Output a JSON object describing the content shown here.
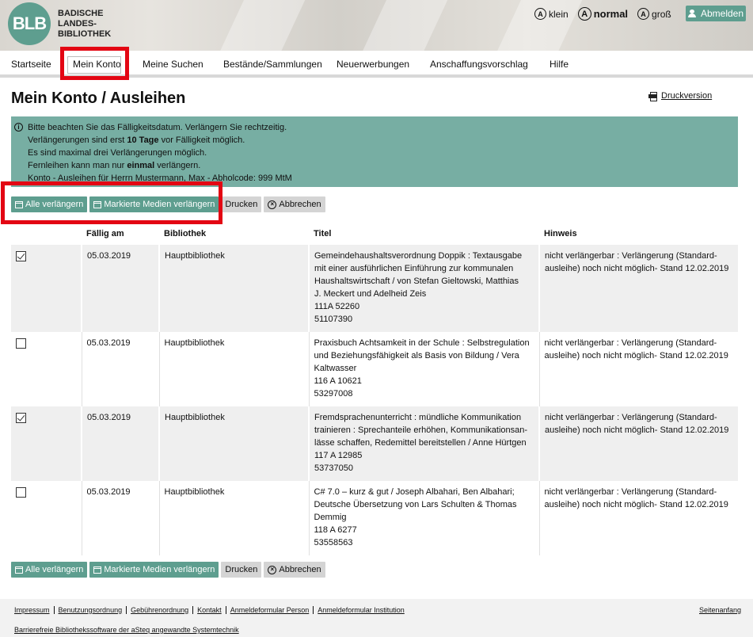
{
  "header": {
    "logo_short": "BLB",
    "logo_lines": [
      "BADISCHE",
      "LANDES-",
      "BIBLIOTHEK"
    ],
    "font_sizes": [
      {
        "symbol": "A",
        "label": "klein"
      },
      {
        "symbol": "A",
        "label": "normal"
      },
      {
        "symbol": "A",
        "label": "groß"
      }
    ],
    "logout_label": "Abmelden",
    "logout_icon": "user-icon"
  },
  "nav": {
    "items": [
      "Startseite",
      "Mein Konto",
      "Meine Suchen",
      "Bestände/Sammlungen",
      "Neuerwerbungen",
      "Anschaffungsvorschlag",
      "Hilfe"
    ],
    "active": "Mein Konto"
  },
  "page": {
    "title": "Mein Konto / Ausleihen",
    "print_label": "Druckversion",
    "print_icon": "printer-icon"
  },
  "notice": {
    "icon": "info-icon",
    "line1": "Bitte beachten Sie das Fälligkeitsdatum. Verlängern Sie rechtzeitig.",
    "line2_pre": "Verlängerungen sind erst ",
    "line2_bold": "10 Tage",
    "line2_post": " vor Fälligkeit möglich.",
    "line3": "Es sind maximal drei Verlängerungen möglich.",
    "line4_pre": "Fernleihen kann man nur ",
    "line4_bold": "einmal",
    "line4_post": " verlängern.",
    "line5": "Konto - Ausleihen für Herrn Mustermann, Max - Abholcode: 999 MtM"
  },
  "buttons": {
    "renew_all": "Alle verlängern",
    "renew_marked": "Markierte Medien verlängern",
    "print": "Drucken",
    "cancel": "Abbrechen"
  },
  "table": {
    "headers": [
      "",
      "Fällig am",
      "Bibliothek",
      "Titel",
      "Hinweis"
    ],
    "rows": [
      {
        "checked": true,
        "due": "05.03.2019",
        "library": "Hauptbibliothek",
        "title_lines": [
          "Gemeindehaushaltsverordnung Doppik : Textausgabe",
          "mit einer ausführlichen Einführung zur kommunalen",
          "Haushaltswirtschaft / von Stefan Gieltowski, Matthias",
          "J. Meckert und Adelheid Zeis",
          "111A 52260",
          "51107390"
        ],
        "note_lines": [
          "nicht verlängerbar : Verlängerung (Standard-",
          "ausleihe) noch nicht möglich- Stand 12.02.2019"
        ]
      },
      {
        "checked": false,
        "due": "05.03.2019",
        "library": "Hauptbibliothek",
        "title_lines": [
          "Praxisbuch Achtsamkeit in der Schule : Selbstregulation",
          "und Beziehungsfähigkeit als Basis von Bildung / Vera",
          "Kaltwasser",
          "116 A 10621",
          "53297008"
        ],
        "note_lines": [
          "nicht verlängerbar : Verlängerung (Standard-",
          "ausleihe) noch nicht möglich- Stand 12.02.2019"
        ]
      },
      {
        "checked": true,
        "due": "05.03.2019",
        "library": "Hauptbibliothek",
        "title_lines": [
          "Fremdsprachenunterricht : mündliche Kommunikation",
          "trainieren : Sprechanteile erhöhen, Kommunikationsan-",
          "lässe schaffen, Redemittel bereitstellen / Anne Hürtgen",
          "117 A 12985",
          "53737050"
        ],
        "note_lines": [
          "nicht verlängerbar : Verlängerung (Standard-",
          "ausleihe) noch nicht möglich- Stand 12.02.2019"
        ]
      },
      {
        "checked": false,
        "due": "05.03.2019",
        "library": "Hauptbibliothek",
        "title_lines": [
          "C# 7.0 – kurz & gut / Joseph Albahari, Ben Albahari;",
          "Deutsche Übersetzung von Lars Schulten & Thomas",
          "Demmig",
          "118 A 6277",
          "53558563"
        ],
        "note_lines": [
          "nicht verlängerbar : Verlängerung (Standard-",
          "ausleihe) noch nicht möglich- Stand 12.02.2019"
        ]
      }
    ]
  },
  "footer": {
    "links": [
      "Impressum",
      "Benutzungsordnung",
      "Gebührenordnung",
      "Kontakt",
      "Anmeldeformular Person",
      "Anmeldeformular Institution"
    ],
    "to_top": "Seitenanfang",
    "credit": "Barrierefreie Bibliothekssoftware der aSteq angewandte Systemtechnik"
  },
  "colors": {
    "accent": "#5e9e8f",
    "notice_bg": "#77aea3",
    "highlight": "#e30613"
  }
}
